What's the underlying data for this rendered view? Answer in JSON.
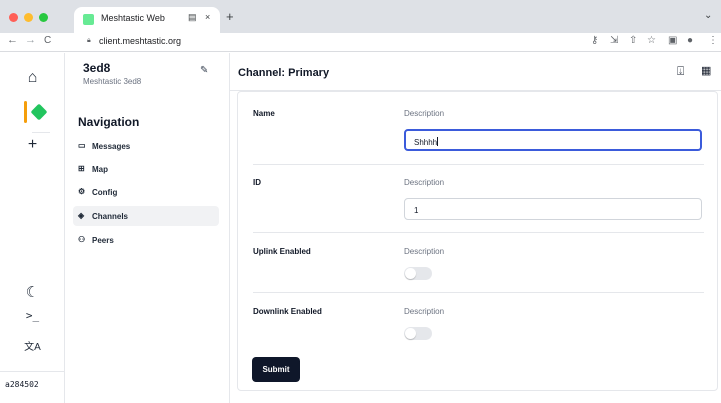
{
  "colors": {
    "accent": "#f59e0b",
    "node_green": "#22c55e",
    "favicon_green": "#67ea94",
    "focus_blue": "#3b5bdb",
    "button_dark": "#0f172a",
    "traffic_red": "#ff5f57",
    "traffic_yellow": "#febc2e",
    "traffic_green": "#28c840"
  },
  "browser": {
    "tab_title": "Meshtastic Web",
    "tab_close": "×",
    "new_tab": "+",
    "tab_menu": "⌄",
    "url": "client.meshtastic.org",
    "back": "←",
    "forward": "→",
    "reload": "C",
    "icons": [
      "key-icon",
      "install-icon",
      "share-icon",
      "star-icon",
      "sidebar-icon",
      "profile-icon",
      "kebab-menu-icon"
    ]
  },
  "rail": {
    "home_icon": "⌂",
    "add_icon": "+",
    "theme_icon": "☾",
    "terminal_icon": ">_",
    "language_icon": "文A",
    "node_id": "a284502"
  },
  "sidebar": {
    "device_name": "3ed8",
    "device_subtitle": "Meshtastic 3ed8",
    "nav_heading": "Navigation",
    "items": [
      {
        "label": "Messages",
        "icon": "message-icon"
      },
      {
        "label": "Map",
        "icon": "map-icon"
      },
      {
        "label": "Config",
        "icon": "settings-icon"
      },
      {
        "label": "Channels",
        "icon": "layers-icon"
      },
      {
        "label": "Peers",
        "icon": "users-icon"
      }
    ],
    "active_item": "Channels"
  },
  "main": {
    "title": "Channel: Primary",
    "header_icons": [
      "import-icon",
      "qr-code-icon"
    ]
  },
  "form": {
    "fields": [
      {
        "label": "Name",
        "description": "Description",
        "type": "text",
        "value": "Shhhh",
        "focused": true
      },
      {
        "label": "ID",
        "description": "Description",
        "type": "text",
        "value": "1"
      },
      {
        "label": "Uplink Enabled",
        "description": "Description",
        "type": "toggle",
        "value": false
      },
      {
        "label": "Downlink Enabled",
        "description": "Description",
        "type": "toggle",
        "value": false
      }
    ],
    "submit_label": "Submit"
  }
}
